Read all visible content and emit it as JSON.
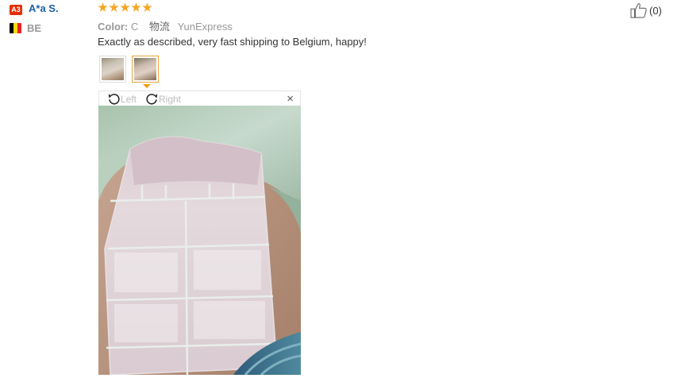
{
  "user": {
    "level_badge": "A3",
    "name": "A*a S.",
    "country_code": "BE",
    "flag_colors": [
      "#000000",
      "#f5d90a",
      "#e8212e"
    ]
  },
  "review": {
    "rating": 5,
    "star_color": "#f5a623",
    "color_label": "Color:",
    "color_value": "C",
    "shipping_label": "物流",
    "shipping_value": "YunExpress",
    "text": "Exactly as described, very fast shipping to Belgium, happy!"
  },
  "thumbnails": [
    {
      "name": "photo-1",
      "active": false
    },
    {
      "name": "photo-2",
      "active": true
    }
  ],
  "viewer": {
    "rotate_left_label": "Left",
    "rotate_right_label": "Right",
    "close_icon": "×"
  },
  "helpful": {
    "count_label": "(0)",
    "icon": "thumbs-up-icon"
  }
}
